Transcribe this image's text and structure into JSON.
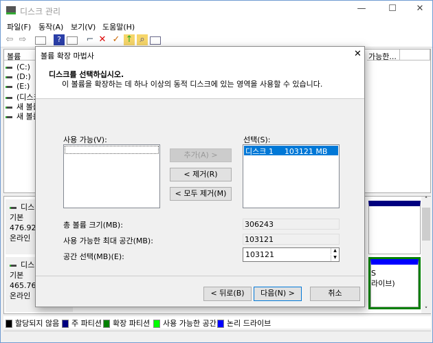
{
  "window": {
    "title": "디스크 관리",
    "minimize": "—",
    "maximize": "☐",
    "close": "✕"
  },
  "menu": [
    "파일(F)",
    "동작(A)",
    "보기(V)",
    "도움말(H)"
  ],
  "toolbar": [
    "back-icon",
    "forward-icon",
    "console-tree-icon",
    "help-icon",
    "action-pane-icon",
    "connect-icon",
    "delete-icon",
    "properties-icon",
    "up-icon",
    "find-icon",
    "list-icon"
  ],
  "volume_list": {
    "columns": [
      "볼륨",
      "가능한..."
    ],
    "rows": [
      "(C:)",
      "(D:)",
      "(E:)",
      "(디스크",
      "새 볼륨",
      "새 볼륨"
    ]
  },
  "disks": [
    {
      "name": "디스",
      "type": "기본",
      "size": "476.92 G",
      "status": "온라인"
    },
    {
      "name": "디스",
      "type": "기본",
      "size": "465.76 G",
      "status": "온라인",
      "part_text1": "S",
      "part_text2": "라이브)"
    }
  ],
  "legend": [
    {
      "label": "할당되지 않음",
      "color": "#000000"
    },
    {
      "label": "주 파티션",
      "color": "#000080"
    },
    {
      "label": "확장 파티션",
      "color": "#008000"
    },
    {
      "label": "사용 가능한 공간",
      "color": "#00ff00"
    },
    {
      "label": "논리 드라이브",
      "color": "#0000ff"
    }
  ],
  "dialog": {
    "title": "볼륨 확장 마법사",
    "close": "✕",
    "heading": "디스크를 선택하십시오.",
    "subheading": "이 볼륨을 확장하는 데 하나 이상의 동적 디스크에 있는 영역을 사용할 수 있습니다.",
    "available_label": "사용 가능(V):",
    "selected_label": "선택(S):",
    "selected_items": [
      {
        "disk": "디스크 1",
        "size": "103121 MB"
      }
    ],
    "add": "추가(A) >",
    "remove": "< 제거(R)",
    "remove_all": "< 모두 제거(M)",
    "total_label": "총 볼륨 크기(MB):",
    "total_value": "306243",
    "max_label": "사용 가능한 최대 공간(MB):",
    "max_value": "103121",
    "select_label": "공간 선택(MB)(E):",
    "select_value": "103121",
    "back": "< 뒤로(B)",
    "next": "다음(N) >",
    "cancel": "취소"
  }
}
